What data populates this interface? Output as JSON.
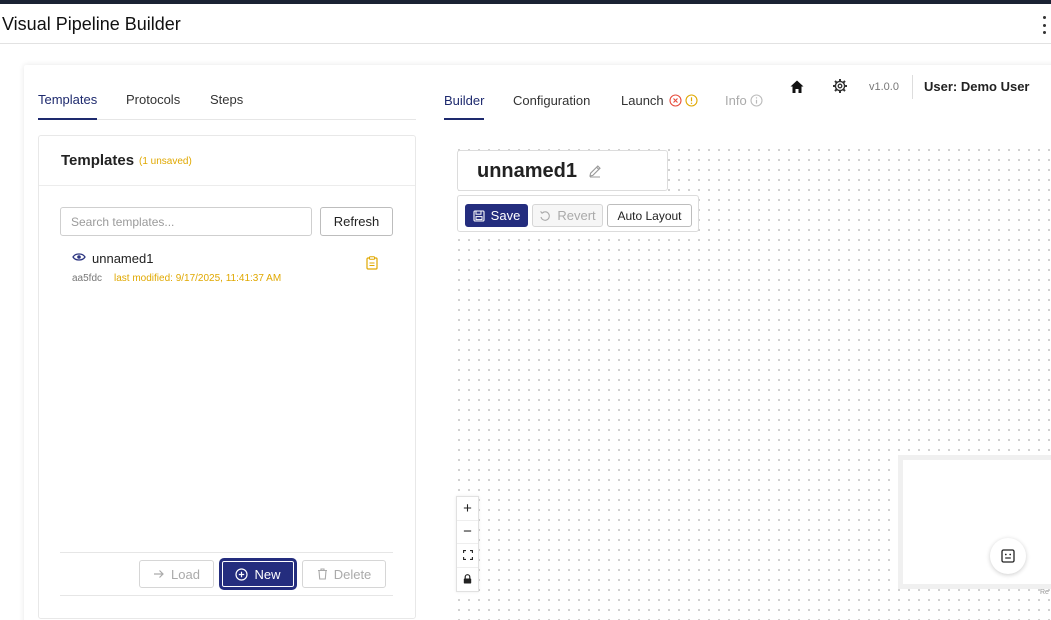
{
  "app": {
    "title": "Visual Pipeline Builder"
  },
  "left_tabs": [
    {
      "label": "Templates",
      "active": true
    },
    {
      "label": "Protocols",
      "active": false
    },
    {
      "label": "Steps",
      "active": false
    }
  ],
  "templates_panel": {
    "title": "Templates",
    "unsaved_badge": "(1 unsaved)",
    "search": {
      "placeholder": "Search templates...",
      "value": ""
    },
    "refresh_label": "Refresh",
    "items": [
      {
        "name": "unnamed1",
        "id": "aa5fdc",
        "modified": "last modified: 9/17/2025, 11:41:37 AM"
      }
    ],
    "load_label": "Load",
    "new_label": "New",
    "delete_label": "Delete"
  },
  "right_tabs": [
    {
      "label": "Builder",
      "active": true
    },
    {
      "label": "Configuration",
      "active": false
    },
    {
      "label": "Launch",
      "active": false
    },
    {
      "label": "Info",
      "active": false
    }
  ],
  "header": {
    "version": "v1.0.0",
    "user": "User: Demo User"
  },
  "builder": {
    "pipeline_name": "unnamed1",
    "save_label": "Save",
    "revert_label": "Revert",
    "auto_layout_label": "Auto Layout"
  },
  "zoom": {
    "zoom_in": "+",
    "zoom_out": "−"
  },
  "canvas": {
    "attribution": "Re"
  },
  "colors": {
    "accent": "#242d7e",
    "warning": "#e0a800",
    "error": "#e74c3c",
    "top_strip": "#1a2233"
  },
  "icons": [
    "kebab-menu-icon",
    "eye-icon",
    "clipboard-icon",
    "arrow-right-icon",
    "plus-circle-icon",
    "trash-icon",
    "error-circle-icon",
    "warning-circle-icon",
    "info-circle-icon",
    "home-icon",
    "gear-icon",
    "pencil-icon",
    "save-disk-icon",
    "revert-icon",
    "fit-view-icon",
    "lock-icon",
    "bot-icon"
  ]
}
